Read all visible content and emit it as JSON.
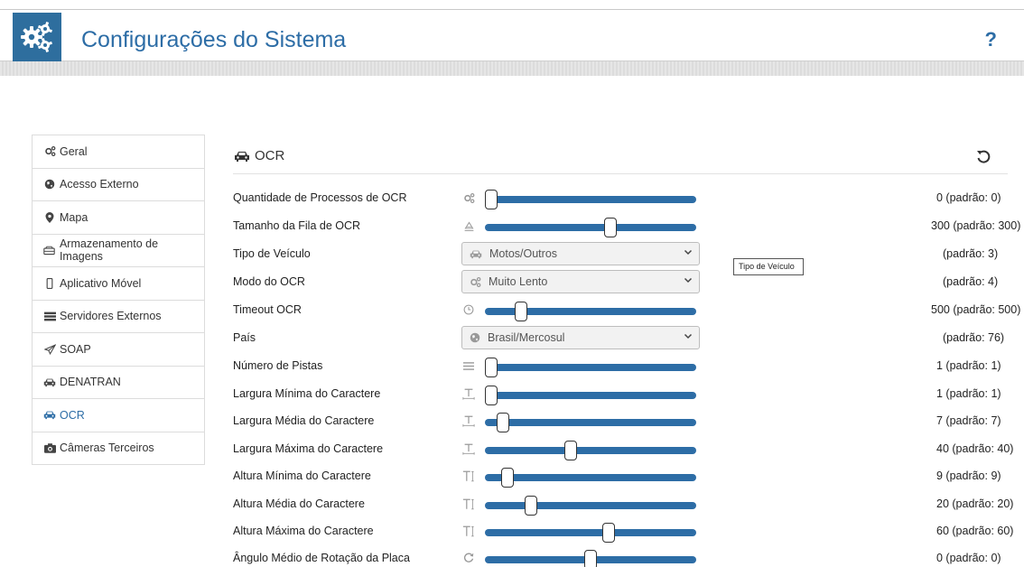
{
  "header": {
    "title": "Configurações do Sistema",
    "help": "?"
  },
  "sidebar": {
    "items": [
      {
        "label": "Geral",
        "icon": "gears-icon"
      },
      {
        "label": "Acesso Externo",
        "icon": "globe-icon"
      },
      {
        "label": "Mapa",
        "icon": "map-marker-icon"
      },
      {
        "label": "Armazenamento de Imagens",
        "icon": "hdd-icon"
      },
      {
        "label": "Aplicativo Móvel",
        "icon": "mobile-icon"
      },
      {
        "label": "Servidores Externos",
        "icon": "server-icon"
      },
      {
        "label": "SOAP",
        "icon": "paper-plane-icon"
      },
      {
        "label": "DENATRAN",
        "icon": "car-icon"
      },
      {
        "label": "OCR",
        "icon": "car-icon",
        "active": true
      },
      {
        "label": "Câmeras Terceiros",
        "icon": "camera-icon"
      }
    ]
  },
  "panel": {
    "title": "OCR",
    "reset_icon": "undo-icon",
    "rows": [
      {
        "label": "Quantidade de Processos de OCR",
        "type": "slider",
        "icon": "gears-icon",
        "position": 0.0,
        "value": "0  (padrão: 0)"
      },
      {
        "label": "Tamanho da Fila de OCR",
        "type": "slider",
        "icon": "stack-icon",
        "position": 0.6,
        "value": "300  (padrão: 300)"
      },
      {
        "label": "Tipo de Veículo",
        "type": "select",
        "icon": "car-icon",
        "selected": "Motos/Outros",
        "value": "(padrão: 3)"
      },
      {
        "label": "Modo do OCR",
        "type": "select",
        "icon": "gears-icon",
        "selected": "Muito Lento",
        "value": "(padrão: 4)"
      },
      {
        "label": "Timeout OCR",
        "type": "slider",
        "icon": "clock-icon",
        "position": 0.15,
        "value": "500  (padrão: 500)"
      },
      {
        "label": "País",
        "type": "select",
        "icon": "globe-icon",
        "selected": "Brasil/Mercosul",
        "value": "(padrão: 76)"
      },
      {
        "label": "Número de Pistas",
        "type": "slider",
        "icon": "lines-icon",
        "position": 0.0,
        "value": "1  (padrão: 1)"
      },
      {
        "label": "Largura Mínima do Caractere",
        "type": "slider",
        "icon": "text-width-icon",
        "position": 0.0,
        "value": "1  (padrão: 1)"
      },
      {
        "label": "Largura Média do Caractere",
        "type": "slider",
        "icon": "text-width-icon",
        "position": 0.06,
        "value": "7  (padrão: 7)"
      },
      {
        "label": "Largura Máxima do Caractere",
        "type": "slider",
        "icon": "text-width-icon",
        "position": 0.4,
        "value": "40  (padrão: 40)"
      },
      {
        "label": "Altura Mínima do Caractere",
        "type": "slider",
        "icon": "text-height-icon",
        "position": 0.08,
        "value": "9  (padrão: 9)"
      },
      {
        "label": "Altura Média do Caractere",
        "type": "slider",
        "icon": "text-height-icon",
        "position": 0.2,
        "value": "20  (padrão: 20)"
      },
      {
        "label": "Altura Máxima do Caractere",
        "type": "slider",
        "icon": "text-height-icon",
        "position": 0.59,
        "value": "60  (padrão: 60)"
      },
      {
        "label": "Ângulo Médio de Rotação da Placa",
        "type": "slider",
        "icon": "rotate-icon",
        "position": 0.5,
        "value": "0  (padrão: 0)"
      }
    ]
  },
  "tooltip": {
    "text": "Tipo de Veículo"
  },
  "colors": {
    "accent": "#2d6da6",
    "logo_bg": "#2e6e9e"
  }
}
